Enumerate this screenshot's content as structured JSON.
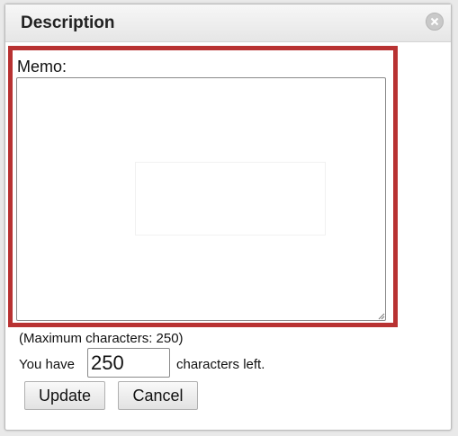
{
  "dialog": {
    "title": "Description",
    "close_icon": "close-circle-icon"
  },
  "memo": {
    "label": "Memo:",
    "value": "",
    "placeholder": ""
  },
  "limits": {
    "max_text": "(Maximum characters: 250)",
    "prefix": "You have",
    "remaining": "250",
    "suffix": "characters left."
  },
  "buttons": {
    "update": "Update",
    "cancel": "Cancel"
  },
  "colors": {
    "highlight": "#b83232"
  }
}
